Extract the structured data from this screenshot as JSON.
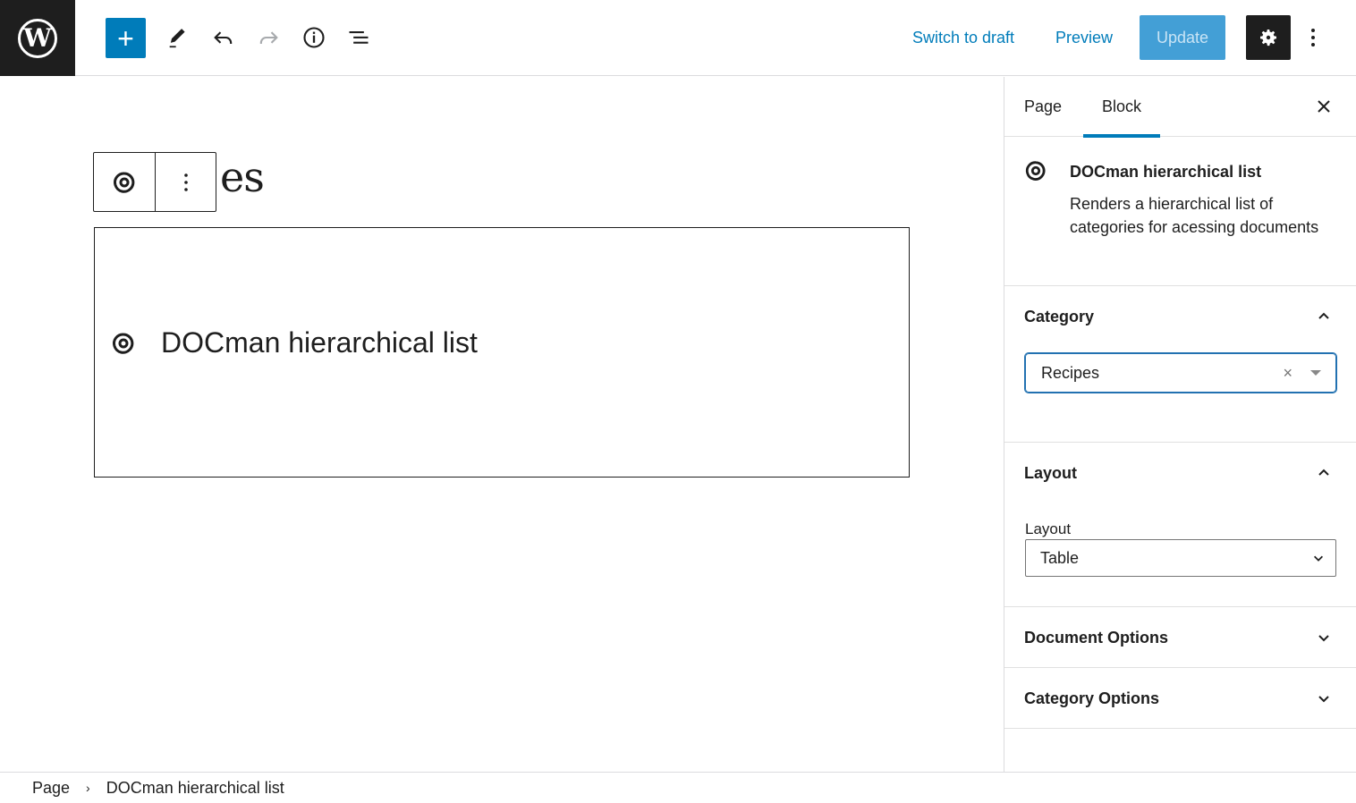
{
  "topbar": {
    "add_label": "+",
    "switch_to_draft": "Switch to draft",
    "preview": "Preview",
    "update": "Update"
  },
  "canvas": {
    "heading_fragment": "es",
    "block_title": "DOCman hierarchical list"
  },
  "sidebar": {
    "tabs": [
      {
        "label": "Page",
        "active": false
      },
      {
        "label": "Block",
        "active": true
      }
    ],
    "block_card": {
      "title": "DOCman hierarchical list",
      "description": "Renders a hierarchical list of categories for acessing documents"
    },
    "category_panel": {
      "title": "Category",
      "selected": "Recipes",
      "expanded": true
    },
    "layout_panel": {
      "title": "Layout",
      "field_label": "Layout",
      "selected": "Table",
      "expanded": true
    },
    "document_options": {
      "title": "Document Options",
      "expanded": false
    },
    "category_options": {
      "title": "Category Options",
      "expanded": false
    }
  },
  "breadcrumb": {
    "items": [
      "Page",
      "DOCman hierarchical list"
    ]
  },
  "colors": {
    "accent": "#007cba",
    "dark": "#1e1e1e"
  }
}
